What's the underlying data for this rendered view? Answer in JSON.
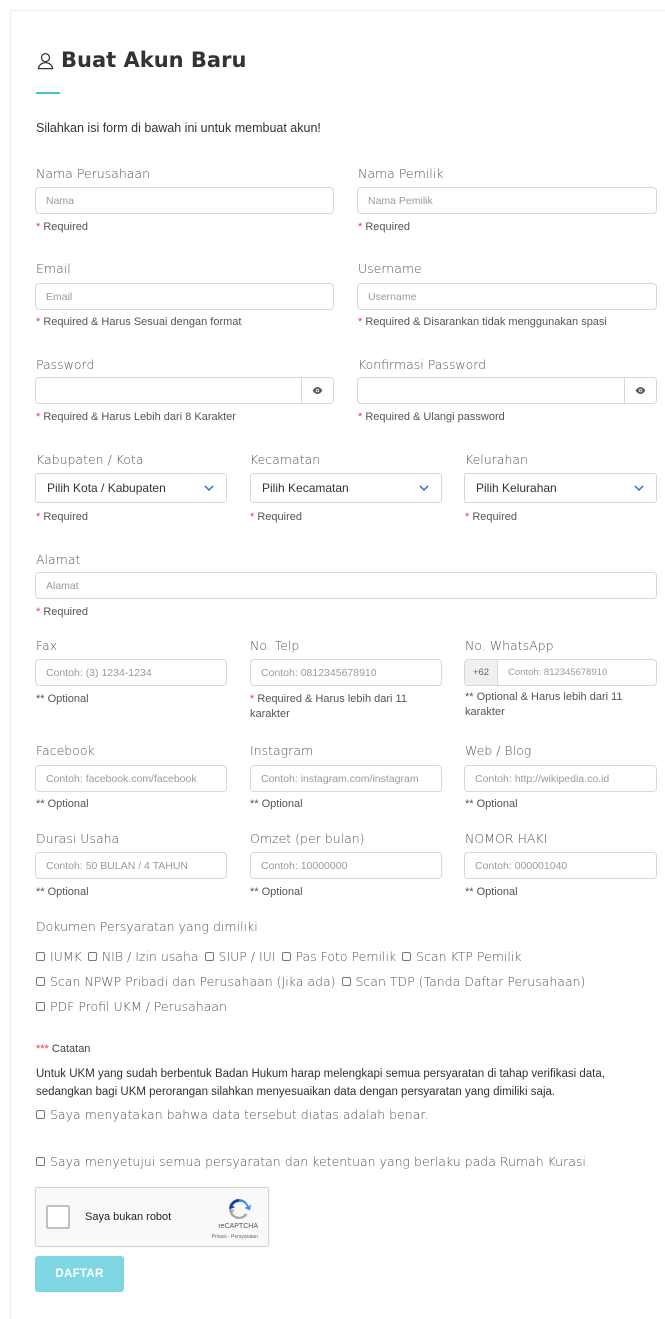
{
  "header": {
    "title": "Buat Akun Baru",
    "intro": "Silahkan isi form di bawah ini untuk membuat akun!"
  },
  "fields": {
    "nama_perusahaan": {
      "label": "Nama Perusahaan",
      "placeholder": "Nama",
      "hint_star": "*",
      "hint": " Required"
    },
    "nama_pemilik": {
      "label": "Nama Pemilik",
      "placeholder": "Nama Pemilik",
      "hint_star": "*",
      "hint": " Required"
    },
    "email": {
      "label": "Email",
      "placeholder": "Email",
      "hint_star": "*",
      "hint": " Required & Harus Sesuai dengan format"
    },
    "username": {
      "label": "Username",
      "placeholder": "Username",
      "hint_star": "*",
      "hint": " Required & Disarankan tidak menggunakan spasi"
    },
    "password": {
      "label": "Password",
      "placeholder": "",
      "hint_star": "*",
      "hint": " Required & Harus Lebih dari 8 Karakter"
    },
    "konfirmasi_password": {
      "label": "Konfirmasi Password",
      "placeholder": "",
      "hint_star": "*",
      "hint": " Required & Ulangi password"
    },
    "kabupaten": {
      "label": "Kabupaten / Kota",
      "selected": "Pilih Kota / Kabupaten",
      "hint_star": "*",
      "hint": " Required"
    },
    "kecamatan": {
      "label": "Kecamatan",
      "selected": "Pilih Kecamatan",
      "hint_star": "*",
      "hint": " Required"
    },
    "kelurahan": {
      "label": "Kelurahan",
      "selected": "Pilih Kelurahan",
      "hint_star": "*",
      "hint": " Required"
    },
    "alamat": {
      "label": "Alamat",
      "placeholder": "Alamat",
      "hint_star": "*",
      "hint": " Required"
    },
    "fax": {
      "label": "Fax",
      "placeholder": "Contoh: (3) 1234-1234",
      "hint": "** Optional"
    },
    "telp": {
      "label": "No. Telp",
      "placeholder": "Contoh: 0812345678910",
      "hint_star": "*",
      "hint": " Required & Harus lebih dari 11 karakter"
    },
    "whatsapp": {
      "label": "No. WhatsApp",
      "prefix": "+62",
      "placeholder": "Contoh: 812345678910",
      "hint": "** Optional & Harus lebih dari 11 karakter"
    },
    "facebook": {
      "label": "Facebook",
      "placeholder": "Contoh: facebook.com/facebook",
      "hint": "** Optional"
    },
    "instagram": {
      "label": "Instagram",
      "placeholder": "Contoh: instagram.com/instagram",
      "hint": "** Optional"
    },
    "web": {
      "label": "Web / Blog",
      "placeholder": "Contoh: http://wikipedia.co.id",
      "hint": "** Optional"
    },
    "durasi": {
      "label": "Durasi Usaha",
      "placeholder": "Contoh: 50 BULAN / 4 TAHUN",
      "hint": "** Optional"
    },
    "omzet": {
      "label": "Omzet (per bulan)",
      "placeholder": "Contoh: 10000000",
      "hint": "** Optional"
    },
    "haki": {
      "label": "NOMOR HAKI",
      "placeholder": "Contoh: 000001040",
      "hint": "** Optional"
    }
  },
  "documents": {
    "label": "Dokumen Persyaratan yang dimiliki",
    "items": [
      "IUMK",
      "NIB / Izin usaha",
      "SIUP / IUI",
      "Pas Foto Pemilik",
      "Scan KTP Pemilik",
      "Scan NPWP Pribadi dan Perusahaan (Jika ada)",
      "Scan TDP (Tanda Daftar Perusahaan)",
      "PDF Profil UKM / Perusahaan"
    ]
  },
  "note": {
    "star": "***",
    "title": " Catatan",
    "text": "Untuk UKM yang sudah berbentuk Badan Hukum harap melengkapi semua persyaratan di tahap verifikasi data, sedangkan bagi UKM perorangan silahkan menyesuaikan data dengan persyaratan yang dimiliki saja."
  },
  "agreements": {
    "data_benar": "Saya menyatakan bahwa data tersebut diatas adalah benar.",
    "setuju": "Saya menyetujui semua persyaratan dan ketentuan yang berlaku pada Rumah Kurasi."
  },
  "captcha": {
    "label": "Saya bukan robot",
    "brand": "reCAPTCHA",
    "terms": "Privasi - Persyaratan"
  },
  "submit_label": "DAFTAR",
  "colors": {
    "accent": "#3cc4d4",
    "button": "#7fd7e4",
    "required": "#e8413b"
  }
}
